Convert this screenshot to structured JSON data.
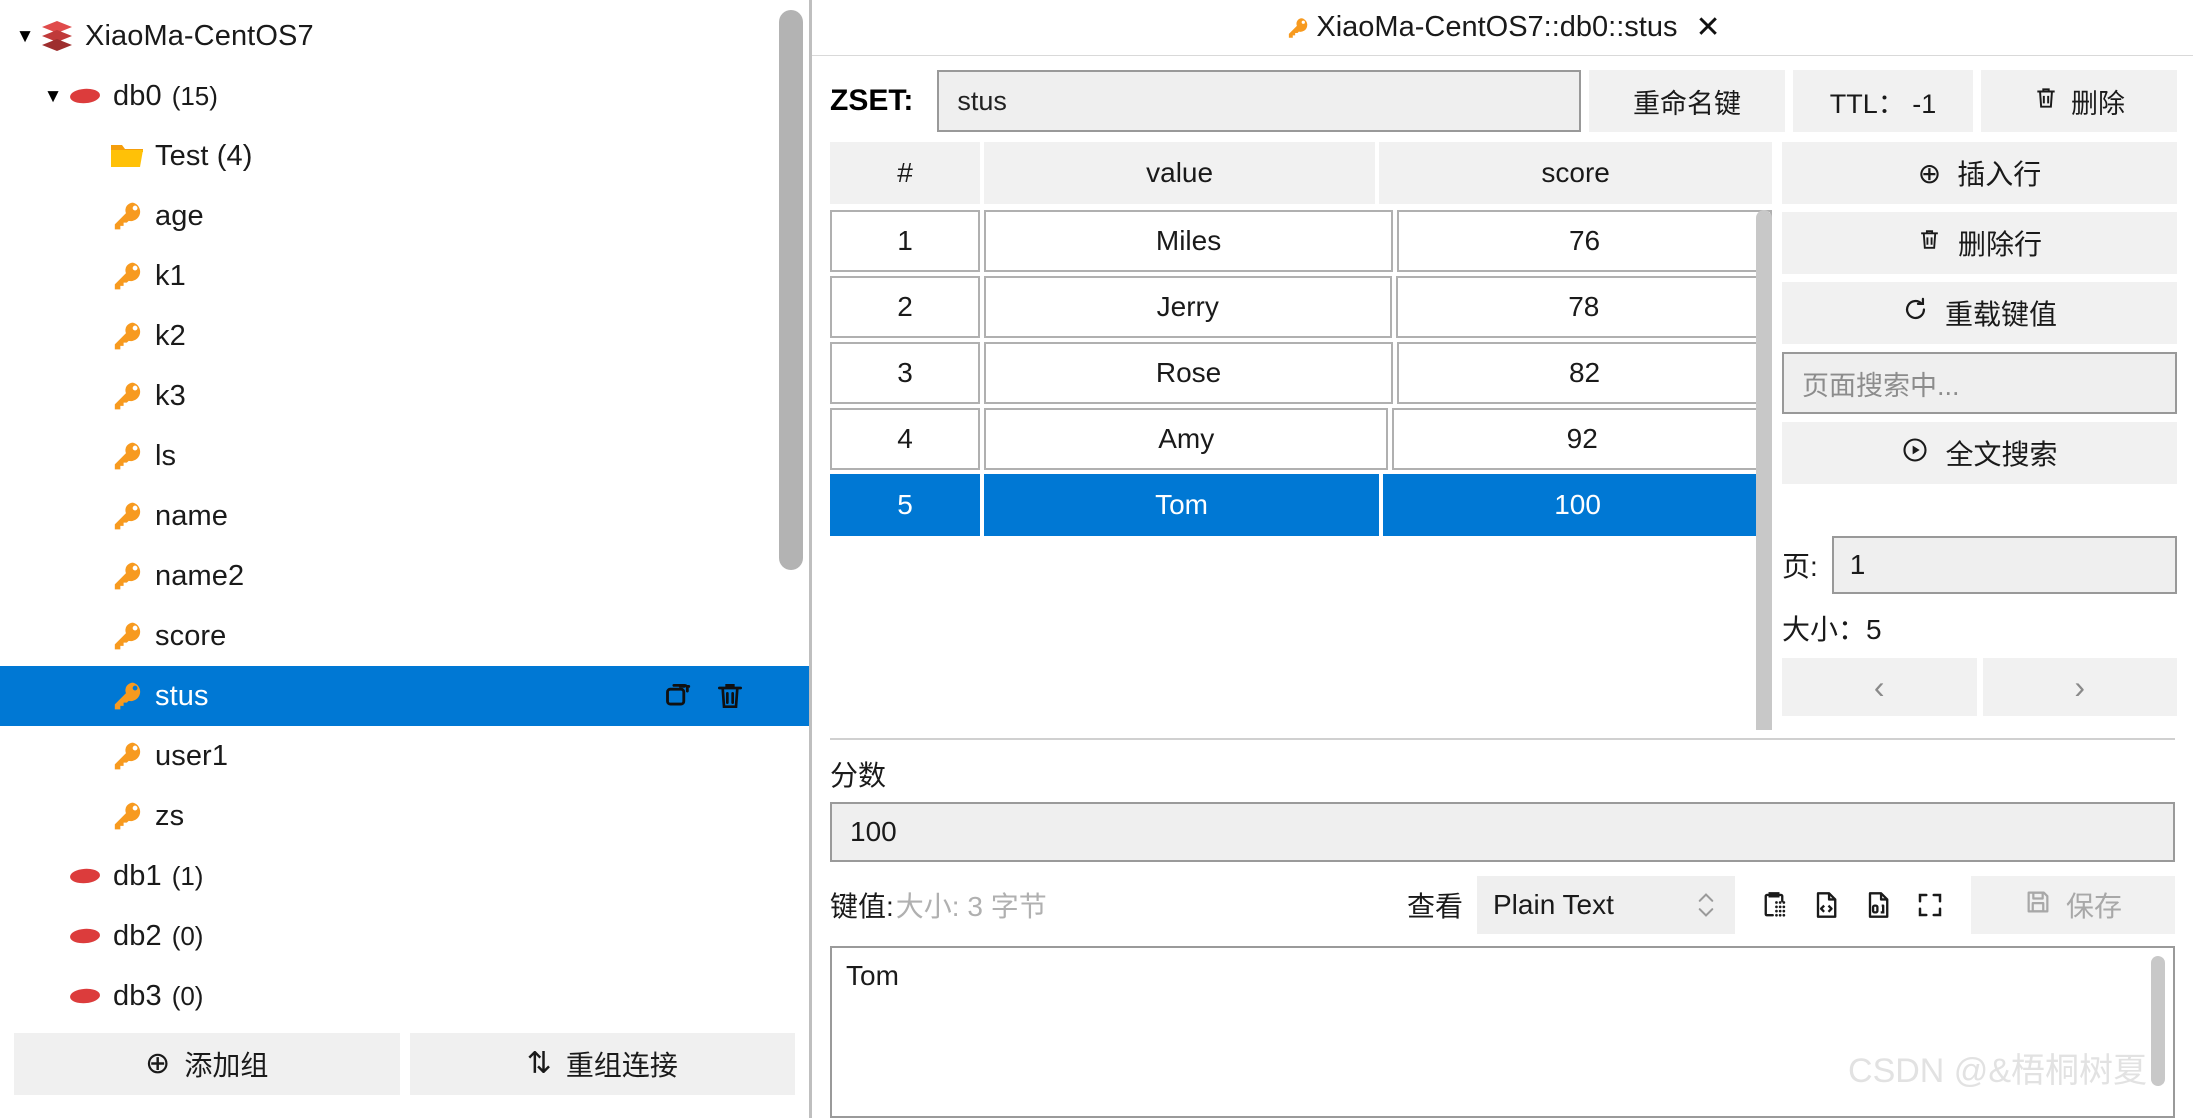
{
  "sidebar": {
    "tree": [
      {
        "level": 0,
        "caret": "▼",
        "icon": "stack-icon",
        "label": "XiaoMa-CentOS7",
        "count": ""
      },
      {
        "level": 1,
        "caret": "▼",
        "icon": "database-icon",
        "label": "db0",
        "count": "(15)"
      },
      {
        "level": 2,
        "caret": "",
        "icon": "folder-icon",
        "label": "Test (4)",
        "count": ""
      },
      {
        "level": 2,
        "caret": "",
        "icon": "key-icon",
        "label": "age",
        "count": ""
      },
      {
        "level": 2,
        "caret": "",
        "icon": "key-icon",
        "label": "k1",
        "count": ""
      },
      {
        "level": 2,
        "caret": "",
        "icon": "key-icon",
        "label": "k2",
        "count": ""
      },
      {
        "level": 2,
        "caret": "",
        "icon": "key-icon",
        "label": "k3",
        "count": ""
      },
      {
        "level": 2,
        "caret": "",
        "icon": "key-icon",
        "label": "ls",
        "count": ""
      },
      {
        "level": 2,
        "caret": "",
        "icon": "key-icon",
        "label": "name",
        "count": ""
      },
      {
        "level": 2,
        "caret": "",
        "icon": "key-icon",
        "label": "name2",
        "count": ""
      },
      {
        "level": 2,
        "caret": "",
        "icon": "key-icon",
        "label": "score",
        "count": ""
      },
      {
        "level": 2,
        "caret": "",
        "icon": "key-icon",
        "label": "stus",
        "count": "",
        "selected": true
      },
      {
        "level": 2,
        "caret": "",
        "icon": "key-icon",
        "label": "user1",
        "count": ""
      },
      {
        "level": 2,
        "caret": "",
        "icon": "key-icon",
        "label": "zs",
        "count": ""
      },
      {
        "level": 1,
        "caret": "",
        "icon": "database-icon",
        "label": "db1",
        "count": "(1)"
      },
      {
        "level": 1,
        "caret": "",
        "icon": "database-icon",
        "label": "db2",
        "count": "(0)"
      },
      {
        "level": 1,
        "caret": "",
        "icon": "database-icon",
        "label": "db3",
        "count": "(0)"
      }
    ],
    "row_actions": [
      "copy-link-icon",
      "trash-icon"
    ],
    "footer": {
      "add_group_label": "添加组",
      "add_group_icon": "plus-circle-icon",
      "reconnect_label": "重组连接",
      "reconnect_icon": "sort-arrows-icon"
    }
  },
  "tab": {
    "icon": "key-icon",
    "title": "XiaoMa-CentOS7::db0::stus",
    "close_icon": "close-icon"
  },
  "key_header": {
    "type_label": "ZSET:",
    "key_name": "stus",
    "rename_label": "重命名键",
    "ttl_label": "TTL： -1",
    "delete_label": "删除",
    "delete_icon": "trash-icon"
  },
  "table": {
    "columns": [
      "#",
      "value",
      "score"
    ],
    "rows": [
      {
        "idx": "1",
        "value": "Miles",
        "score": "76",
        "selected": false
      },
      {
        "idx": "2",
        "value": "Jerry",
        "score": "78",
        "selected": false
      },
      {
        "idx": "3",
        "value": "Rose",
        "score": "82",
        "selected": false
      },
      {
        "idx": "4",
        "value": "Amy",
        "score": "92",
        "selected": false
      },
      {
        "idx": "5",
        "value": "Tom",
        "score": "100",
        "selected": true
      }
    ]
  },
  "side_buttons": {
    "insert_row_label": "插入行",
    "insert_row_icon": "plus-circle-icon",
    "delete_row_label": "删除行",
    "delete_row_icon": "trash-icon",
    "reload_label": "重载键值",
    "reload_icon": "refresh-icon",
    "search_placeholder": "页面搜索中...",
    "fulltext_label": "全文搜索",
    "fulltext_icon": "play-circle-icon"
  },
  "pager": {
    "page_label": "页:",
    "page_value": "1",
    "size_label": "大小：5",
    "prev_icon": "chevron-left-icon",
    "next_icon": "chevron-right-icon"
  },
  "detail": {
    "score_label": "分数",
    "score_value": "100",
    "keyvalue_label": "键值:",
    "keyvalue_size": "大小: 3 字节",
    "view_label": "查看",
    "view_mode": "Plain Text",
    "toolbar_icons": [
      "clipboard-dots-icon",
      "code-file-icon",
      "binary-file-icon",
      "fullscreen-icon"
    ],
    "save_label": "保存",
    "save_icon": "floppy-disk-icon",
    "value_text": "Tom"
  },
  "watermark": "CSDN @&梧桐树夏",
  "colors": {
    "selection_blue": "#0078d4",
    "key_orange": "#F79A1F",
    "db_red": "#DC3C3C",
    "folder_yellow": "#FFC107",
    "panel_gray": "#F1F1F1"
  }
}
